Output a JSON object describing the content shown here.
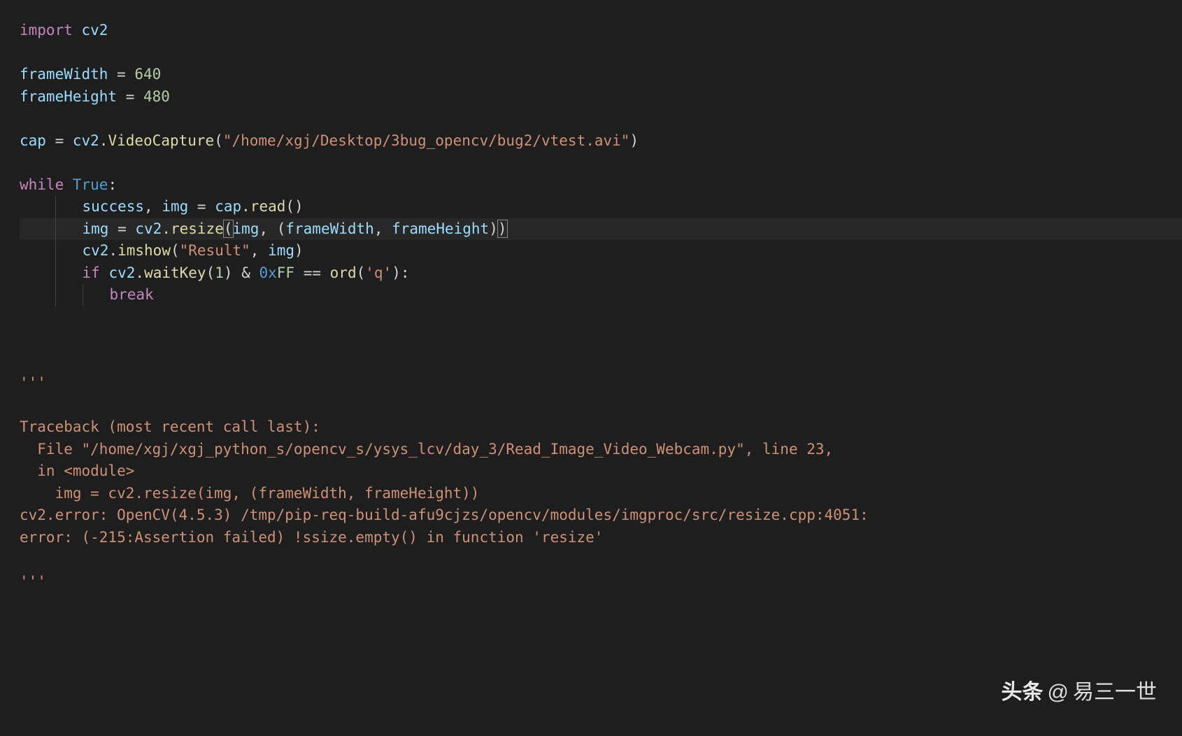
{
  "code": {
    "l1": {
      "import": "import",
      "mod": "cv2"
    },
    "l2": "",
    "l3": {
      "var": "frameWidth",
      "op": " = ",
      "val": "640"
    },
    "l4": {
      "var": "frameHeight",
      "op": " = ",
      "val": "480"
    },
    "l5": "",
    "l6": {
      "var": "cap",
      "op": " = ",
      "mod": "cv2",
      "dot": ".",
      "fn": "VideoCapture",
      "open": "(",
      "str": "\"/home/xgj/Desktop/3bug_opencv/bug2/vtest.avi\"",
      "close": ")"
    },
    "l7": "",
    "l8": {
      "kw": "while",
      "sp": " ",
      "true": "True",
      "colon": ":"
    },
    "l9": {
      "var1": "success",
      "comma": ", ",
      "var2": "img",
      "op": " = ",
      "var3": "cap",
      "dot": ".",
      "fn": "read",
      "parens": "()"
    },
    "l10": {
      "var1": "img",
      "op": " = ",
      "mod": "cv2",
      "dot": ".",
      "fn": "resize",
      "open": "(",
      "arg1": "img",
      "comma": ", (",
      "arg2": "frameWidth",
      "comma2": ", ",
      "arg3": "frameHeight",
      "close": ")",
      "close2": ")"
    },
    "l11": {
      "mod": "cv2",
      "dot": ".",
      "fn": "imshow",
      "open": "(",
      "str": "\"Result\"",
      "comma": ", ",
      "arg": "img",
      "close": ")"
    },
    "l12": {
      "kw": "if",
      "sp": " ",
      "mod": "cv2",
      "dot": ".",
      "fn": "waitKey",
      "open": "(",
      "num": "1",
      "close": ")",
      "amp": " & ",
      "hexpre": "0x",
      "hex": "FF",
      "eq": " == ",
      "fn2": "ord",
      "open2": "(",
      "str": "'q'",
      "close2": "):"
    },
    "l13": {
      "kw": "break"
    },
    "l14": ""
  },
  "comment_markers": {
    "open": "'''",
    "close": "'''"
  },
  "traceback": {
    "l1": "Traceback (most recent call last):",
    "l2": "  File \"/home/xgj/xgj_python_s/opencv_s/ysys_lcv/day_3/Read_Image_Video_Webcam.py\", line 23, ",
    "l3": "  in <module>",
    "l4": "    img = cv2.resize(img, (frameWidth, frameHeight))",
    "l5": "cv2.error: OpenCV(4.5.3) /tmp/pip-req-build-afu9cjzs/opencv/modules/imgproc/src/resize.cpp:4051: ",
    "l6": "error: (-215:Assertion failed) !ssize.empty() in function 'resize'"
  },
  "watermark": {
    "brand": "头条",
    "at": "@",
    "user": "易三一世"
  }
}
